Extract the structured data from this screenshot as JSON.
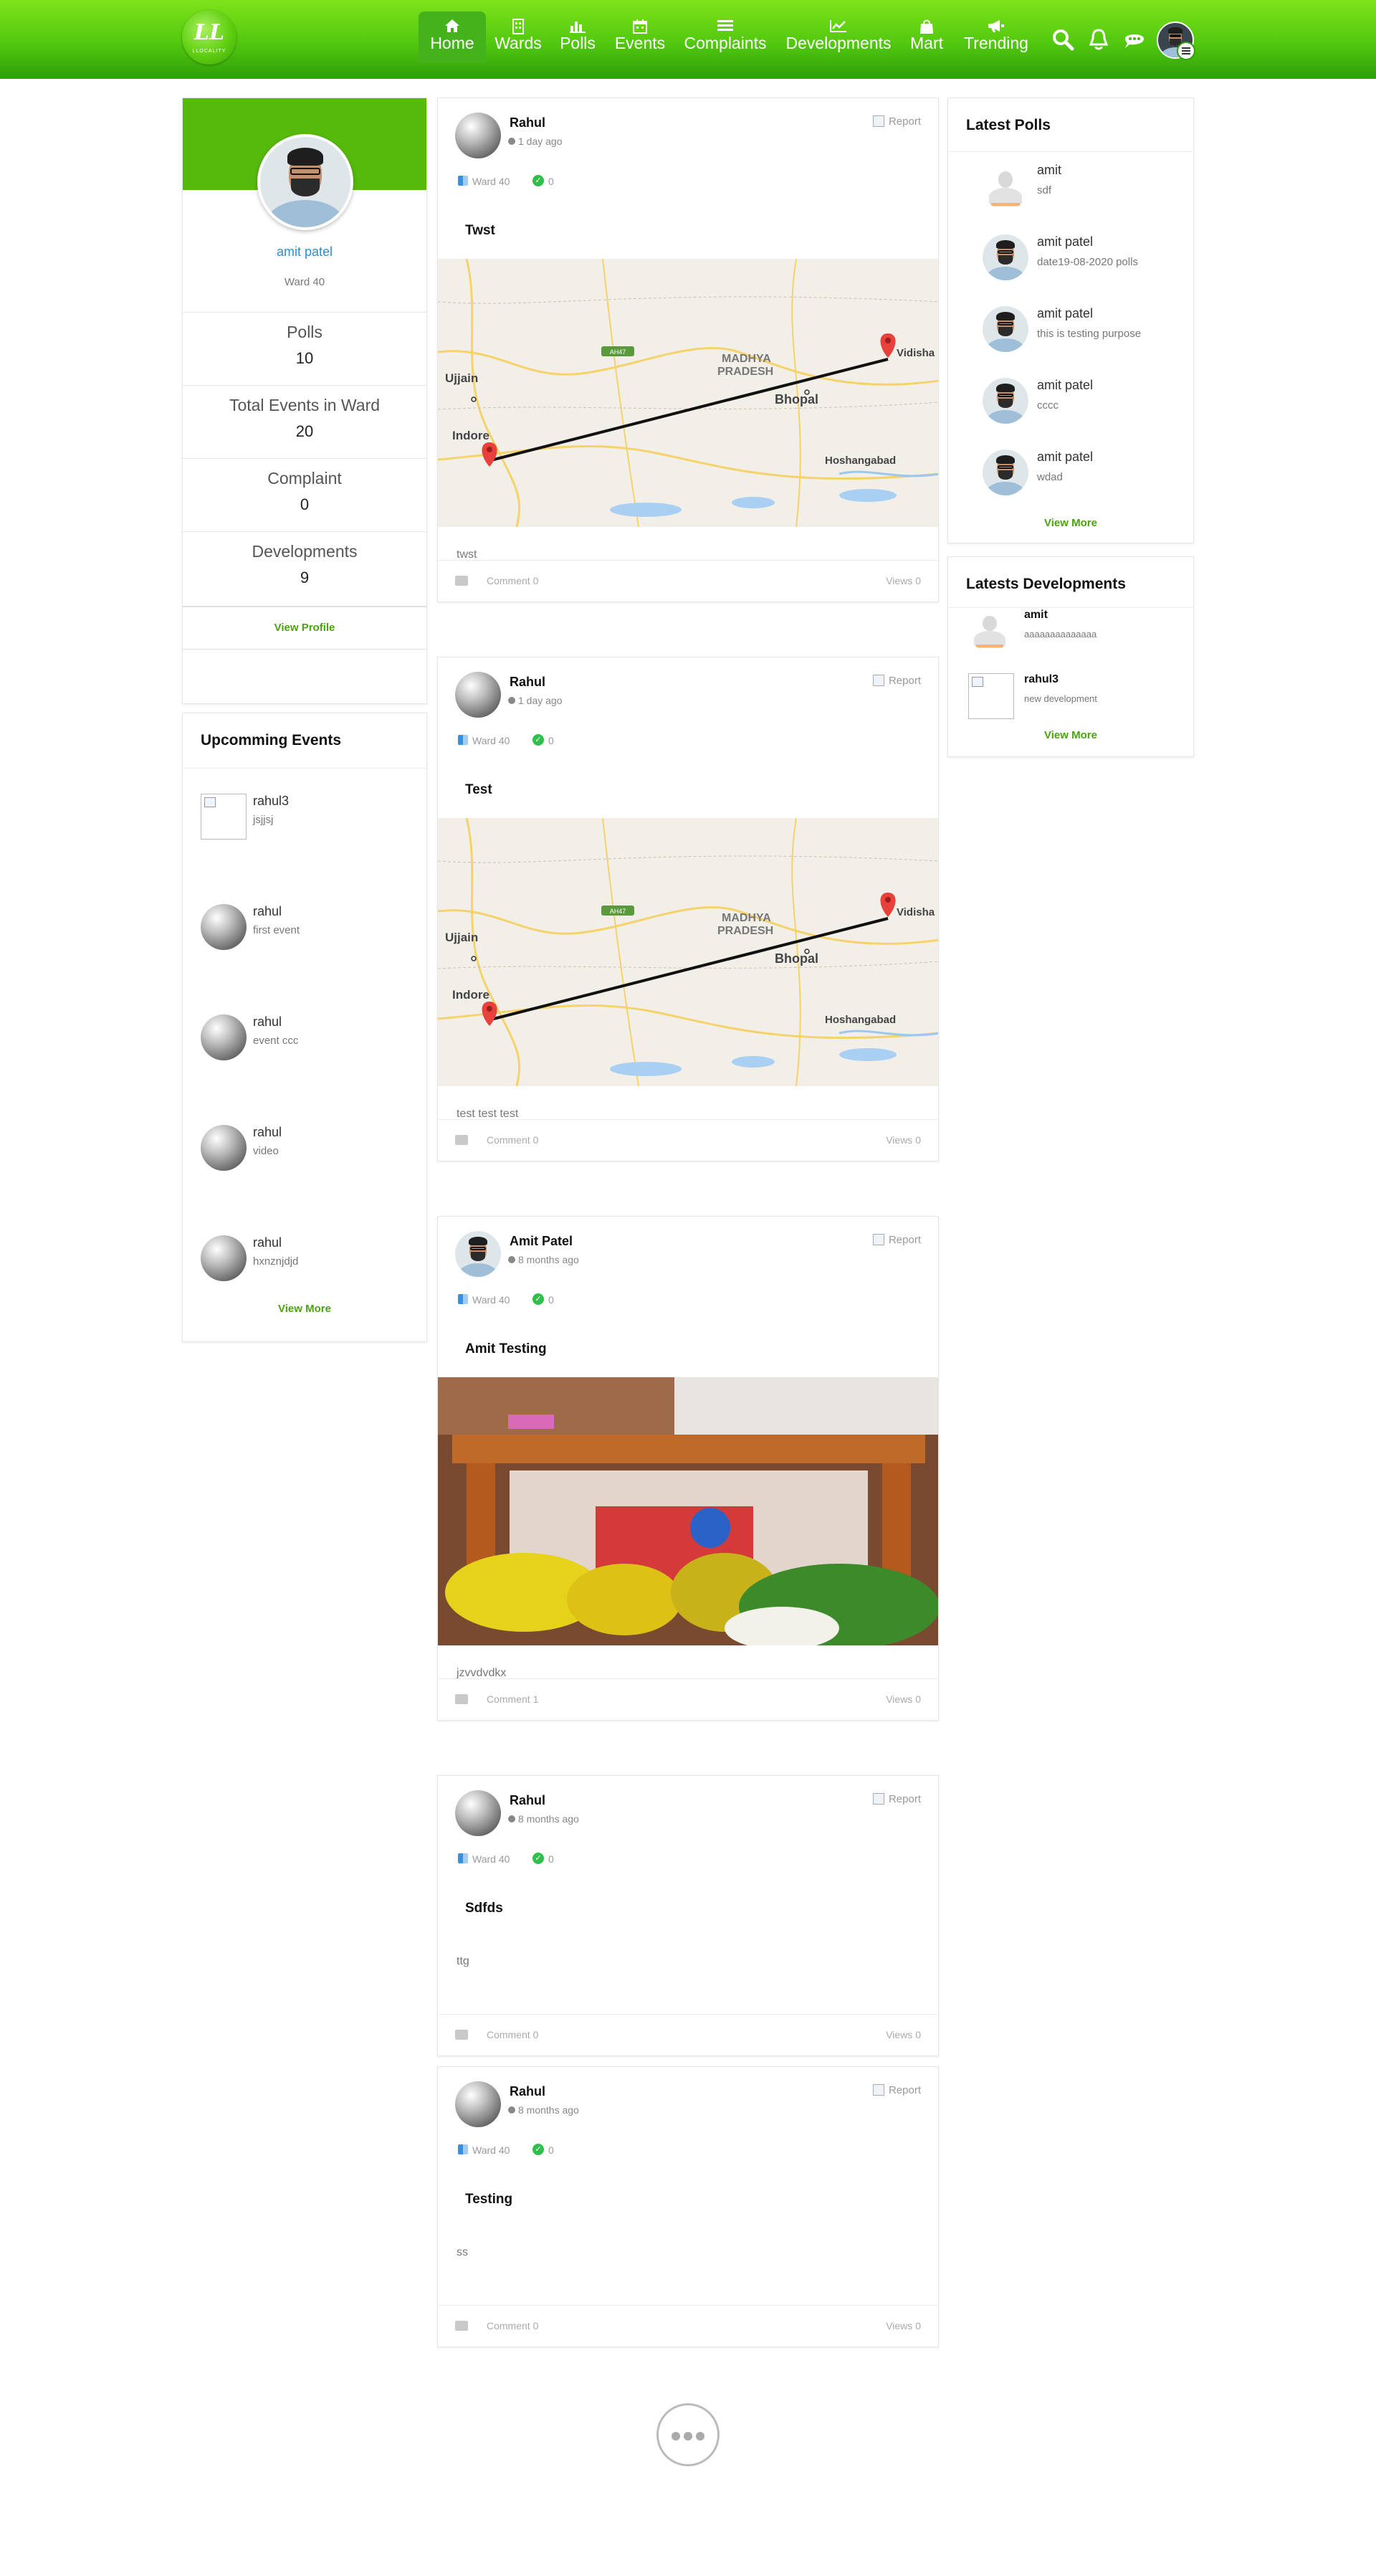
{
  "header": {
    "logo_text": "LLOCALITY",
    "nav": [
      {
        "label": "Home",
        "icon": "home-icon",
        "active": true
      },
      {
        "label": "Wards",
        "icon": "building-icon"
      },
      {
        "label": "Polls",
        "icon": "bar-chart-icon"
      },
      {
        "label": "Events",
        "icon": "calendar-icon"
      },
      {
        "label": "Complaints",
        "icon": "list-icon"
      },
      {
        "label": "Developments",
        "icon": "line-chart-icon"
      },
      {
        "label": "Mart",
        "icon": "shopping-bag-icon"
      },
      {
        "label": "Trending",
        "icon": "megaphone-icon"
      }
    ],
    "actions": [
      "search-icon",
      "bell-icon",
      "chat-icon",
      "avatar"
    ],
    "colors": {
      "brand_green": "#52c80f",
      "dark_green": "#2e9e0a"
    }
  },
  "profile": {
    "name": "amit patel",
    "ward": "Ward 40",
    "stats": [
      {
        "title": "Polls",
        "value": "10"
      },
      {
        "title": "Total Events in Ward",
        "value": "20"
      },
      {
        "title": "Complaint",
        "value": "0"
      },
      {
        "title": "Developments",
        "value": "9"
      }
    ],
    "view_profile": "View Profile"
  },
  "events": {
    "title": "Upcomming Events",
    "items": [
      {
        "name": "rahul3",
        "desc": "jsjjsj",
        "avatar": "broken-image"
      },
      {
        "name": "rahul",
        "desc": "first event",
        "avatar": "sphere"
      },
      {
        "name": "rahul",
        "desc": "event ccc",
        "avatar": "sphere"
      },
      {
        "name": "rahul",
        "desc": "video",
        "avatar": "sphere"
      },
      {
        "name": "rahul",
        "desc": "hxnznjdjd",
        "avatar": "sphere"
      }
    ],
    "view_more": "View More"
  },
  "posts": [
    {
      "author": "Rahul",
      "time": "1 day ago",
      "ward": "Ward 40",
      "count": "0",
      "title": "Twst",
      "media": "map",
      "body": "twst",
      "comments": "Comment 0",
      "views": "Views 0",
      "report": "Report"
    },
    {
      "author": "Rahul",
      "time": "1 day ago",
      "ward": "Ward 40",
      "count": "0",
      "title": "Test",
      "media": "map",
      "body": "test test test",
      "comments": "Comment 0",
      "views": "Views 0",
      "report": "Report"
    },
    {
      "author": "Amit Patel",
      "time": "8 months ago",
      "ward": "Ward 40",
      "count": "0",
      "title": "Amit Testing",
      "media": "photo",
      "body": "jzvvdvdkx",
      "comments": "Comment 1",
      "views": "Views 0",
      "report": "Report"
    },
    {
      "author": "Rahul",
      "time": "8 months ago",
      "ward": "Ward 40",
      "count": "0",
      "title": "Sdfds",
      "media": "none",
      "body": "ttg",
      "comments": "Comment 0",
      "views": "Views 0",
      "report": "Report"
    },
    {
      "author": "Rahul",
      "time": "8 months ago",
      "ward": "Ward 40",
      "count": "0",
      "title": "Testing",
      "media": "none",
      "body": "ss",
      "comments": "Comment 0",
      "views": "Views 0",
      "report": "Report"
    }
  ],
  "map_labels": {
    "ujjain": "Ujjain",
    "indore": "Indore",
    "mp": "MADHYA",
    "mp2": "PRADESH",
    "bhopal": "Bhopal",
    "vidisha": "Vidisha",
    "hoshangabad": "Hoshangabad",
    "highway": "AH47"
  },
  "latest_polls": {
    "title": "Latest Polls",
    "items": [
      {
        "name": "amit",
        "desc": "sdf",
        "avatar": "placeholder"
      },
      {
        "name": "amit patel",
        "desc": "date19-08-2020 polls",
        "avatar": "face"
      },
      {
        "name": "amit patel",
        "desc": "this is testing purpose",
        "avatar": "face"
      },
      {
        "name": "amit patel",
        "desc": "cccc",
        "avatar": "face"
      },
      {
        "name": "amit patel",
        "desc": "wdad",
        "avatar": "face"
      }
    ],
    "view_more": "View More"
  },
  "developments": {
    "title": "Latests Developments",
    "items": [
      {
        "name": "amit",
        "desc": "aaaaaaaaaaaaaa",
        "avatar": "placeholder"
      },
      {
        "name": "rahul3",
        "desc": "new development",
        "avatar": "broken-image"
      }
    ],
    "view_more": "View More"
  }
}
